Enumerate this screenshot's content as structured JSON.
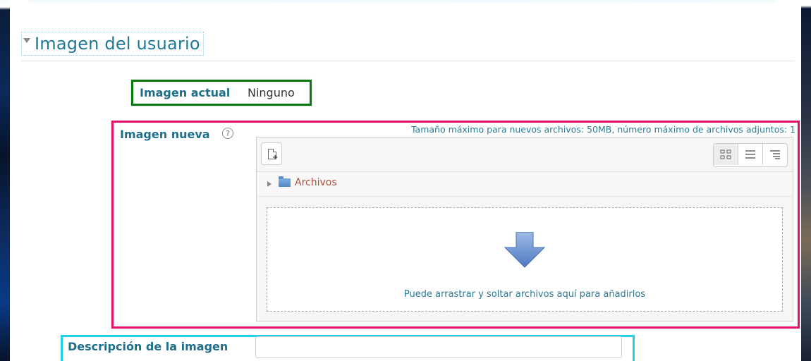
{
  "section": {
    "title": "Imagen del usuario"
  },
  "current_image": {
    "label": "Imagen actual",
    "value": "Ninguno"
  },
  "new_image": {
    "label": "Imagen nueva",
    "limits": "Tamaño máximo para nuevos archivos: 50MB, número máximo de archivos adjuntos: 1",
    "folder_label": "Archivos",
    "dropzone_text": "Puede arrastrar y soltar archivos aquí para añadirlos"
  },
  "description": {
    "label": "Descripción de la imagen",
    "value": ""
  },
  "colors": {
    "highlight_green": "#0a7a10",
    "highlight_pink": "#e8106a",
    "highlight_cyan": "#1fd0e6",
    "label": "#1f6f8b"
  },
  "icons": [
    "collapse-triangle-icon",
    "help-icon",
    "add-file-icon",
    "grid-view-icon",
    "list-view-icon",
    "tree-view-icon",
    "expand-triangle-icon",
    "folder-icon",
    "down-arrow-icon"
  ]
}
